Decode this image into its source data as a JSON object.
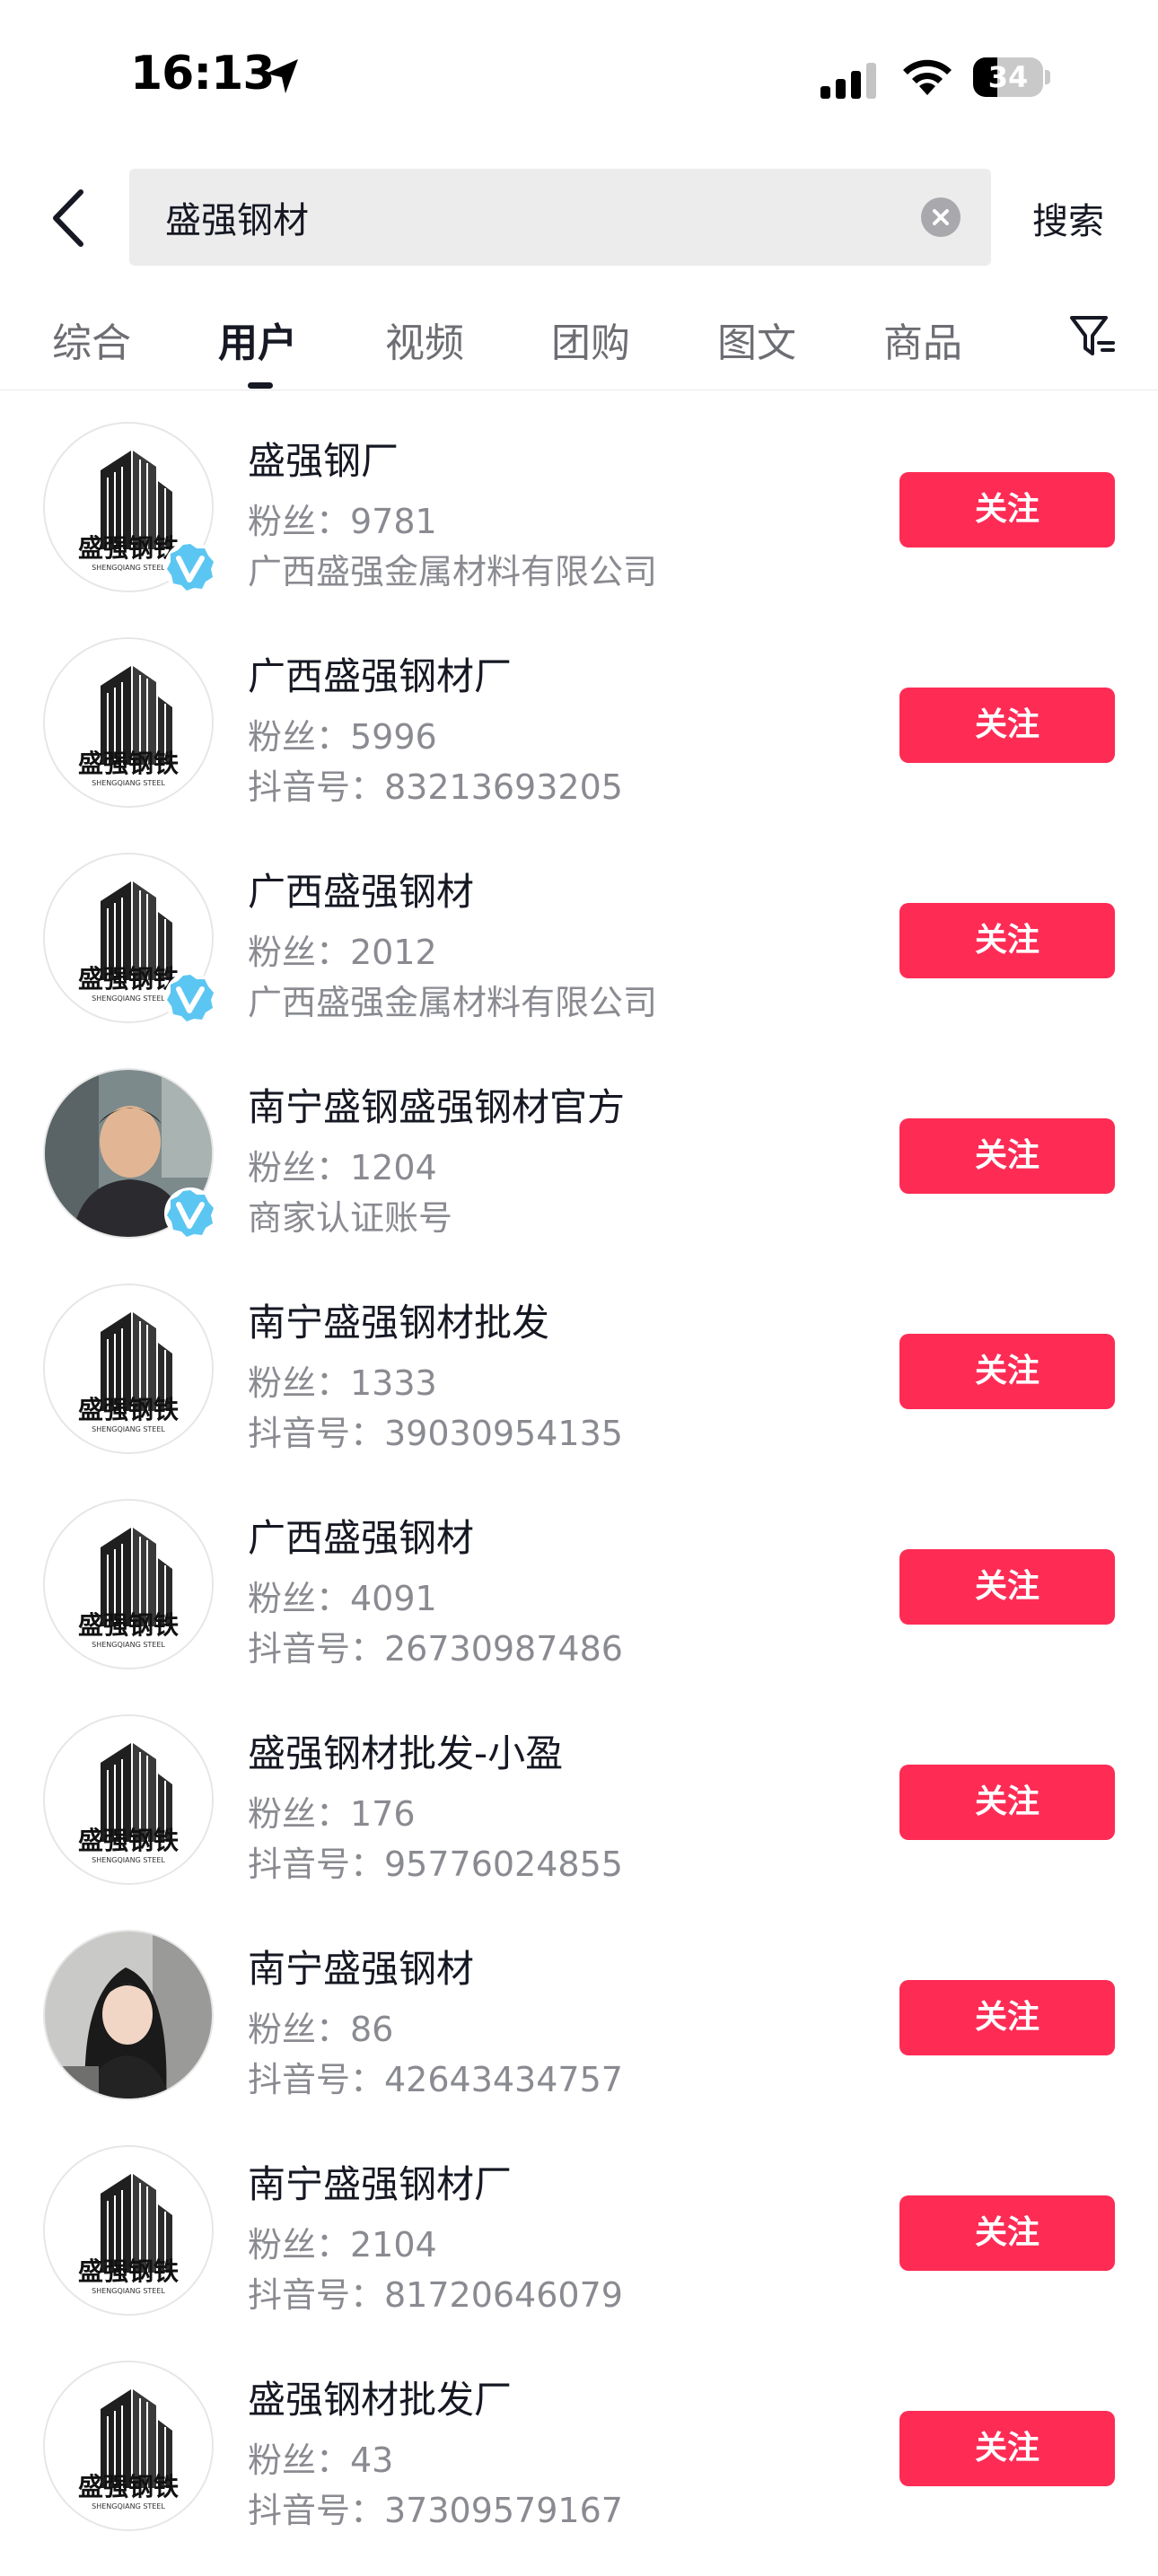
{
  "status_bar": {
    "time": "16:13",
    "battery": "34"
  },
  "search": {
    "query": "盛强钢材",
    "button_label": "搜索"
  },
  "tabs": [
    {
      "label": "综合"
    },
    {
      "label": "用户"
    },
    {
      "label": "视频"
    },
    {
      "label": "团购"
    },
    {
      "label": "图文"
    },
    {
      "label": "商品"
    }
  ],
  "active_tab": "用户",
  "users": [
    {
      "name": "盛强钢厂",
      "followers_label": "粉丝：9781",
      "detail": "广西盛强金属材料有限公司",
      "verified": true,
      "avatar": "logo",
      "follow_label": "关注"
    },
    {
      "name": "广西盛强钢材厂",
      "followers_label": "粉丝：5996",
      "detail": "抖音号：83213693205",
      "verified": false,
      "avatar": "logo",
      "follow_label": "关注"
    },
    {
      "name": "广西盛强钢材",
      "followers_label": "粉丝：2012",
      "detail": "广西盛强金属材料有限公司",
      "verified": true,
      "avatar": "logo",
      "follow_label": "关注"
    },
    {
      "name": "南宁盛钢盛强钢材官方",
      "followers_label": "粉丝：1204",
      "detail": "商家认证账号",
      "verified": true,
      "avatar": "photo-man",
      "follow_label": "关注"
    },
    {
      "name": "南宁盛强钢材批发",
      "followers_label": "粉丝：1333",
      "detail": "抖音号：39030954135",
      "verified": false,
      "avatar": "logo",
      "follow_label": "关注"
    },
    {
      "name": "广西盛强钢材",
      "followers_label": "粉丝：4091",
      "detail": "抖音号：26730987486",
      "verified": false,
      "avatar": "logo",
      "follow_label": "关注"
    },
    {
      "name": "盛强钢材批发-小盈",
      "followers_label": "粉丝：176",
      "detail": "抖音号：95776024855",
      "verified": false,
      "avatar": "logo",
      "follow_label": "关注"
    },
    {
      "name": "南宁盛强钢材",
      "followers_label": "粉丝：86",
      "detail": "抖音号：42643434757",
      "verified": false,
      "avatar": "photo-woman",
      "follow_label": "关注"
    },
    {
      "name": "南宁盛强钢材厂",
      "followers_label": "粉丝：2104",
      "detail": "抖音号：81720646079",
      "verified": false,
      "avatar": "logo",
      "follow_label": "关注"
    },
    {
      "name": "盛强钢材批发厂",
      "followers_label": "粉丝：43",
      "detail": "抖音号：37309579167",
      "verified": false,
      "avatar": "logo",
      "follow_label": "关注"
    }
  ],
  "logo_text": "盛强钢铁",
  "logo_subtext": "SHENGQIANG STEEL",
  "colors": {
    "accent": "#fe2c55",
    "verified": "#5cc6f2"
  }
}
